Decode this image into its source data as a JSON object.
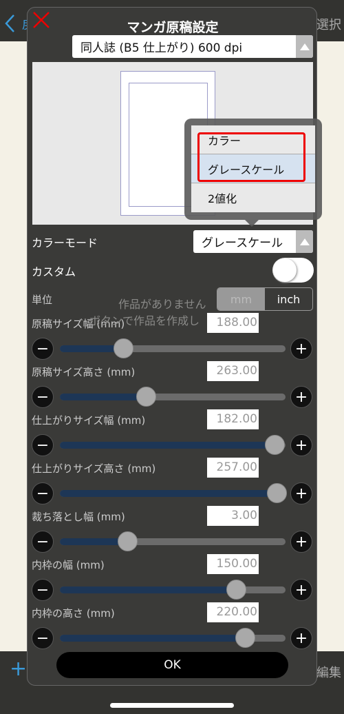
{
  "background": {
    "back_label": "戻る",
    "select_label": "選択",
    "edit_label": "編集",
    "empty_line1": "作品がありません",
    "empty_line2": "ボタンで作品を作成し"
  },
  "dialog": {
    "title": "マンガ原稿設定",
    "preset": "同人誌 (B5 仕上がり) 600 dpi",
    "color_mode": {
      "label": "カラーモード",
      "value": "グレースケール",
      "options": [
        "カラー",
        "グレースケール",
        "2値化"
      ],
      "highlighted": "グレースケール"
    },
    "custom": {
      "label": "カスタム",
      "on": false
    },
    "unit": {
      "label": "単位",
      "options": [
        "mm",
        "inch"
      ],
      "selected": "mm"
    },
    "fields": [
      {
        "label": "原稿サイズ幅 (mm)",
        "value": "188.00",
        "slider": 0.28
      },
      {
        "label": "原稿サイズ高さ (mm)",
        "value": "263.00",
        "slider": 0.38
      },
      {
        "label": "仕上がりサイズ幅 (mm)",
        "value": "182.00",
        "slider": 0.95
      },
      {
        "label": "仕上がりサイズ高さ (mm)",
        "value": "257.00",
        "slider": 0.96
      },
      {
        "label": "裁ち落とし幅 (mm)",
        "value": "3.00",
        "slider": 0.3
      },
      {
        "label": "内枠の幅 (mm)",
        "value": "150.00",
        "slider": 0.78
      },
      {
        "label": "内枠の高さ (mm)",
        "value": "220.00",
        "slider": 0.82
      }
    ],
    "ok_label": "OK"
  },
  "colors": {
    "accent": "#3a9ad9",
    "highlight_box": "#e00000",
    "slider_fill": "#1d3656"
  }
}
